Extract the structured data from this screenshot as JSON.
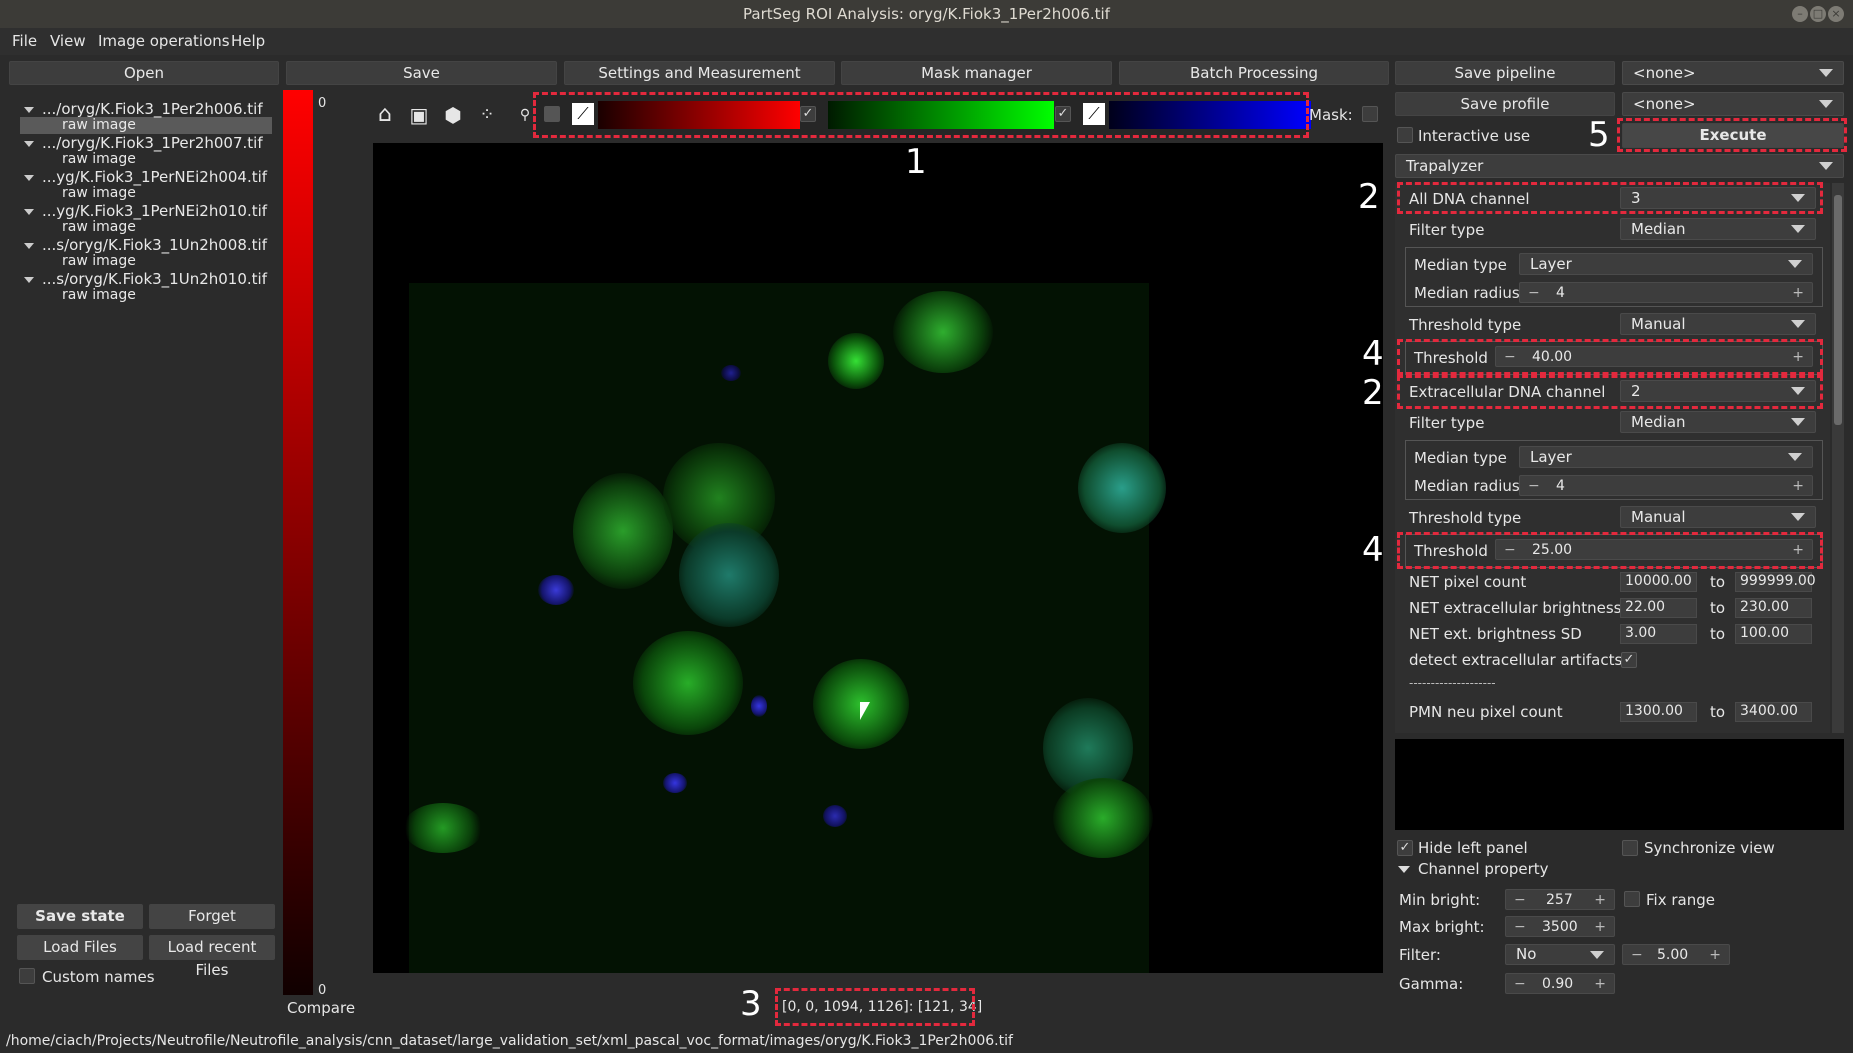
{
  "window": {
    "title": "PartSeg ROI Analysis: oryg/K.Fiok3_1Per2h006.tif"
  },
  "menu": [
    "File",
    "View",
    "Image operations",
    "Help"
  ],
  "toolbar": {
    "open": "Open",
    "save": "Save",
    "settings": "Settings and Measurement",
    "mask_manager": "Mask manager",
    "batch": "Batch Processing",
    "save_pipeline": "Save pipeline",
    "pipeline_value": "<none>",
    "save_profile": "Save profile",
    "profile_value": "<none>"
  },
  "files": [
    {
      "name": ".../oryg/K.Fiok3_1Per2h006.tif",
      "sub": "raw image"
    },
    {
      "name": ".../oryg/K.Fiok3_1Per2h007.tif",
      "sub": "raw image"
    },
    {
      "name": "...yg/K.Fiok3_1PerNEi2h004.tif",
      "sub": "raw image"
    },
    {
      "name": "...yg/K.Fiok3_1PerNEi2h010.tif",
      "sub": "raw image"
    },
    {
      "name": "...s/oryg/K.Fiok3_1Un2h008.tif",
      "sub": "raw image"
    },
    {
      "name": "...s/oryg/K.Fiok3_1Un2h010.tif",
      "sub": "raw image"
    }
  ],
  "left_buttons": {
    "save_state": "Save state",
    "forget": "Forget",
    "load_files": "Load Files",
    "load_recent": "Load recent Files",
    "custom_names": "Custom names"
  },
  "colorbar": {
    "top": "0",
    "bottom": "0",
    "compare": "Compare"
  },
  "viewer": {
    "mask_label": "Mask:",
    "coords": "[0, 0, 1094, 1126]: [121, 34]",
    "channels": [
      {
        "checked": false,
        "color_start": "#1a0000",
        "color_end": "#ff0000"
      },
      {
        "checked": true,
        "color_start": "#001a00",
        "color_end": "#00ff00"
      },
      {
        "checked": true,
        "color_start": "#00001a",
        "color_end": "#0000ff"
      }
    ]
  },
  "annotations": [
    "1",
    "2",
    "2",
    "3",
    "4",
    "4",
    "5"
  ],
  "right": {
    "interactive_use": "Interactive use",
    "execute": "Execute",
    "algorithm": "Trapalyzer",
    "all_dna_label": "All DNA channel",
    "all_dna_value": "3",
    "filter_type_label": "Filter type",
    "filter_type_value": "Median",
    "median_type_label": "Median type",
    "median_type_value": "Layer",
    "median_radius_label": "Median radius",
    "median_radius_value": "4",
    "threshold_type_label": "Threshold type",
    "threshold_type_value": "Manual",
    "threshold_label": "Threshold",
    "threshold1_value": "40.00",
    "extra_dna_label": "Extracellular DNA channel",
    "extra_dna_value": "2",
    "filter_type2_value": "Median",
    "median_type2_value": "Layer",
    "median_radius2_value": "4",
    "threshold_type2_value": "Manual",
    "threshold2_value": "25.00",
    "net_pixel_label": "NET pixel count",
    "net_pixel_from": "10000.00",
    "net_pixel_to": "999999.00",
    "net_bright_label": "NET extracellular brightness",
    "net_bright_from": "22.00",
    "net_bright_to": "230.00",
    "net_sd_label": "NET ext. brightness SD",
    "net_sd_from": "3.00",
    "net_sd_to": "100.00",
    "detect_label": "detect extracellular artifacts",
    "separator": "--------------------",
    "pmn_label": "PMN neu pixel count",
    "pmn_from": "1300.00",
    "pmn_to": "3400.00",
    "to": "to",
    "hide_left": "Hide left panel",
    "sync_view": "Synchronize view",
    "channel_property": "Channel property",
    "min_bright_label": "Min bright:",
    "min_bright_value": "257",
    "fix_range": "Fix range",
    "max_bright_label": "Max bright:",
    "max_bright_value": "3500",
    "filter_label": "Filter:",
    "filter_value": "No",
    "filter_num": "5.00",
    "gamma_label": "Gamma:",
    "gamma_value": "0.90"
  },
  "status_path": "/home/ciach/Projects/Neutrofile/Neutrofile_analysis/cnn_dataset/large_validation_set/xml_pascal_voc_format/images/oryg/K.Fiok3_1Per2h006.tif"
}
